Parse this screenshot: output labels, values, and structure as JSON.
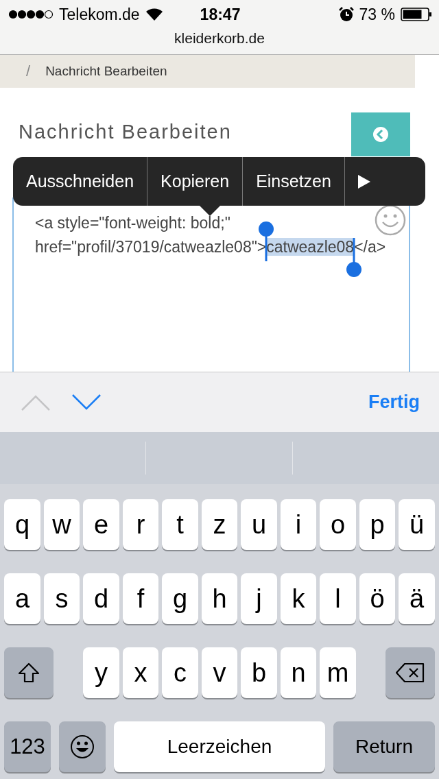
{
  "status_bar": {
    "carrier": "Telekom.de",
    "time": "18:47",
    "battery": "73 %"
  },
  "url_bar": {
    "domain": "kleiderkorb.de"
  },
  "breadcrumb": {
    "separator": "/",
    "current": "Nachricht Bearbeiten"
  },
  "page": {
    "title": "Nachricht Bearbeiten"
  },
  "edit_menu": {
    "items": [
      "Ausschneiden",
      "Kopieren",
      "Einsetzen"
    ]
  },
  "editor": {
    "before": "<a style=\"font-weight: bold;\" href=\"profil/37019/catweazle08\">",
    "selected": "catweazle08",
    "after": "</a>"
  },
  "accessory_bar": {
    "previous": {
      "disabled": true
    },
    "next": {
      "disabled": false
    },
    "done": "Fertig"
  },
  "keyboard": {
    "rows": [
      {
        "keys": [
          {
            "kind": "letter",
            "label": "q"
          },
          {
            "kind": "letter",
            "label": "w"
          },
          {
            "kind": "letter",
            "label": "e"
          },
          {
            "kind": "letter",
            "label": "r"
          },
          {
            "kind": "letter",
            "label": "t"
          },
          {
            "kind": "letter",
            "label": "z"
          },
          {
            "kind": "letter",
            "label": "u"
          },
          {
            "kind": "letter",
            "label": "i"
          },
          {
            "kind": "letter",
            "label": "o"
          },
          {
            "kind": "letter",
            "label": "p"
          },
          {
            "kind": "letter",
            "label": "ü"
          }
        ]
      },
      {
        "keys": [
          {
            "kind": "letter",
            "label": "a"
          },
          {
            "kind": "letter",
            "label": "s"
          },
          {
            "kind": "letter",
            "label": "d"
          },
          {
            "kind": "letter",
            "label": "f"
          },
          {
            "kind": "letter",
            "label": "g"
          },
          {
            "kind": "letter",
            "label": "h"
          },
          {
            "kind": "letter",
            "label": "j"
          },
          {
            "kind": "letter",
            "label": "k"
          },
          {
            "kind": "letter",
            "label": "l"
          },
          {
            "kind": "letter",
            "label": "ö"
          },
          {
            "kind": "letter",
            "label": "ä"
          }
        ]
      },
      {
        "keys": [
          {
            "kind": "shift"
          },
          {
            "kind": "letter",
            "label": "y"
          },
          {
            "kind": "letter",
            "label": "x"
          },
          {
            "kind": "letter",
            "label": "c"
          },
          {
            "kind": "letter",
            "label": "v"
          },
          {
            "kind": "letter",
            "label": "b"
          },
          {
            "kind": "letter",
            "label": "n"
          },
          {
            "kind": "letter",
            "label": "m"
          },
          {
            "kind": "backspace"
          }
        ]
      },
      {
        "keys": [
          {
            "kind": "function",
            "label": "123"
          },
          {
            "kind": "emoji"
          },
          {
            "kind": "space",
            "label": "Leerzeichen"
          },
          {
            "kind": "return",
            "label": "Return"
          }
        ]
      }
    ]
  }
}
